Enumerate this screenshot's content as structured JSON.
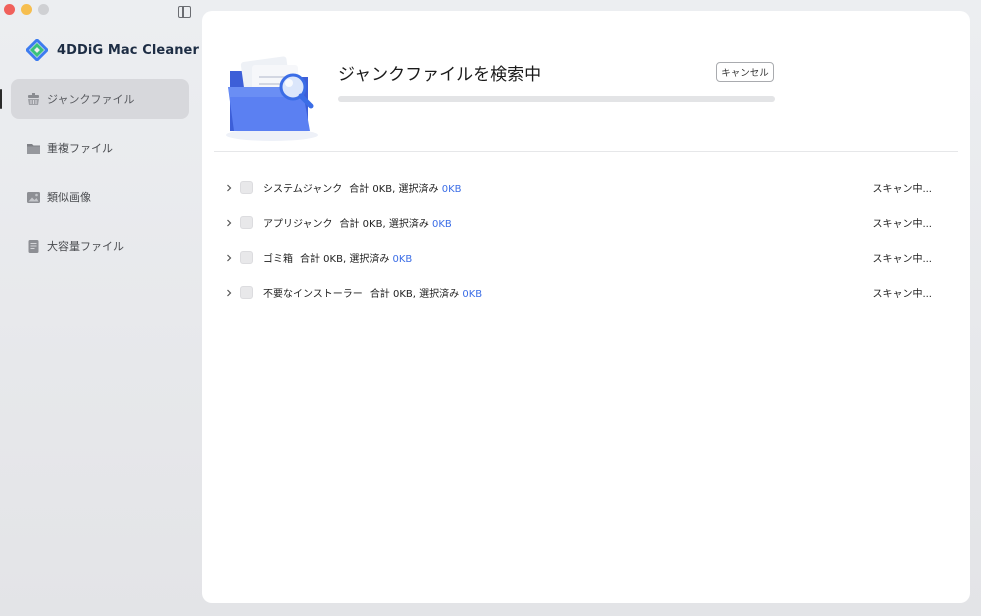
{
  "app": {
    "name": "4DDiG Mac Cleaner",
    "accent_color": "#4f7cf3",
    "logo_icon": "4ddig-diamond-logo"
  },
  "window": {
    "controls": [
      "close",
      "minimize",
      "zoom"
    ],
    "sidebar_toggle_icon": "sidebar-toggle-icon"
  },
  "sidebar": {
    "items": [
      {
        "label": "ジャンクファイル",
        "icon": "broom-icon",
        "active": true
      },
      {
        "label": "重複ファイル",
        "icon": "folder-icon",
        "active": false
      },
      {
        "label": "類似画像",
        "icon": "image-icon",
        "active": false
      },
      {
        "label": "大容量ファイル",
        "icon": "document-icon",
        "active": false
      }
    ]
  },
  "scan": {
    "title": "ジャンクファイルを検索中",
    "cancel_label": "キャンセル",
    "progress": 0
  },
  "categories": [
    {
      "name": "システムジャンク",
      "total_label": "合計 0KB, 選択済み",
      "selected": "0KB",
      "status": "スキャン中..."
    },
    {
      "name": "アプリジャンク",
      "total_label": "合計 0KB, 選択済み",
      "selected": "0KB",
      "status": "スキャン中..."
    },
    {
      "name": "ゴミ箱",
      "total_label": "合計 0KB, 選択済み",
      "selected": "0KB",
      "status": "スキャン中..."
    },
    {
      "name": "不要なインストーラー",
      "total_label": "合計 0KB, 選択済み",
      "selected": "0KB",
      "status": "スキャン中..."
    }
  ]
}
